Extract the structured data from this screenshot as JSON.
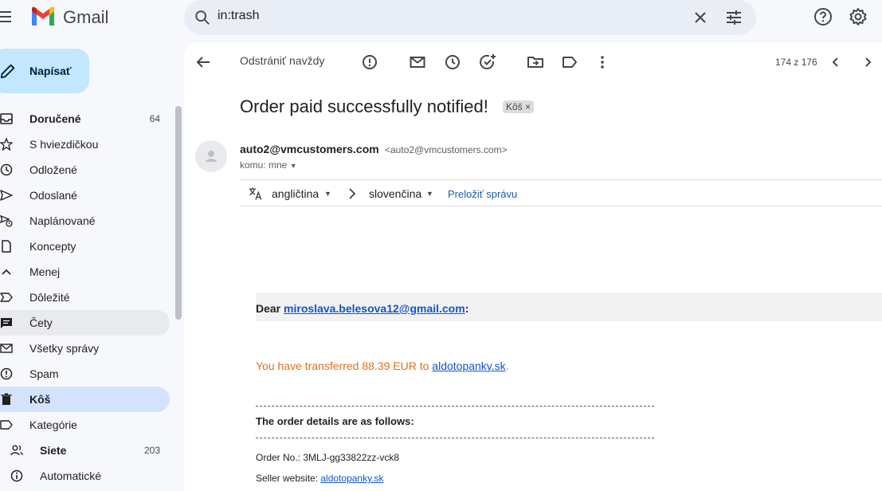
{
  "app": {
    "name": "Gmail"
  },
  "search": {
    "query": "in:trash"
  },
  "compose": {
    "label": "Napísať"
  },
  "sidebar": {
    "items": [
      {
        "label": "Doručené",
        "count": "64"
      },
      {
        "label": "S hviezdičkou"
      },
      {
        "label": "Odložené"
      },
      {
        "label": "Odoslané"
      },
      {
        "label": "Naplánované"
      },
      {
        "label": "Koncepty"
      },
      {
        "label": "Menej"
      },
      {
        "label": "Dôležité"
      },
      {
        "label": "Čety"
      },
      {
        "label": "Všetky správy"
      },
      {
        "label": "Spam"
      },
      {
        "label": "Kôš"
      },
      {
        "label": "Kategórie"
      },
      {
        "label": "Siete",
        "count": "203"
      },
      {
        "label": "Automatické"
      }
    ]
  },
  "toolbar": {
    "delete_forever": "Odstrániť navždy",
    "page_count": "174 z 176"
  },
  "message": {
    "subject": "Order paid successfully notified!",
    "label_chip": "Kôš",
    "from_name": "auto2@vmcustomers.com",
    "from_email": "<auto2@vmcustomers.com>",
    "to_line": "komu: mne"
  },
  "translate": {
    "source_lang": "angličtina",
    "target_lang": "slovenčina",
    "action": "Preložiť správu"
  },
  "body": {
    "dear_prefix": "Dear ",
    "dear_email": "miroslava.belesova12@gmail.com",
    "dear_suffix": ":",
    "transferred_text": "You have transferred 88.39 EUR to ",
    "transferred_link": "aldotopanky.sk",
    "transferred_end": ".",
    "details_title": "The order details are as follows:",
    "order_no": "Order No.: 3MLJ-gg33822zz-vck8",
    "seller_label": "Seller website: ",
    "seller_link": "aldotopanky.sk"
  },
  "colors": {
    "accent": "#c2e7ff",
    "active_nav": "#d3e3fd",
    "link": "#1155cc",
    "transfer_text": "#e0701c"
  }
}
